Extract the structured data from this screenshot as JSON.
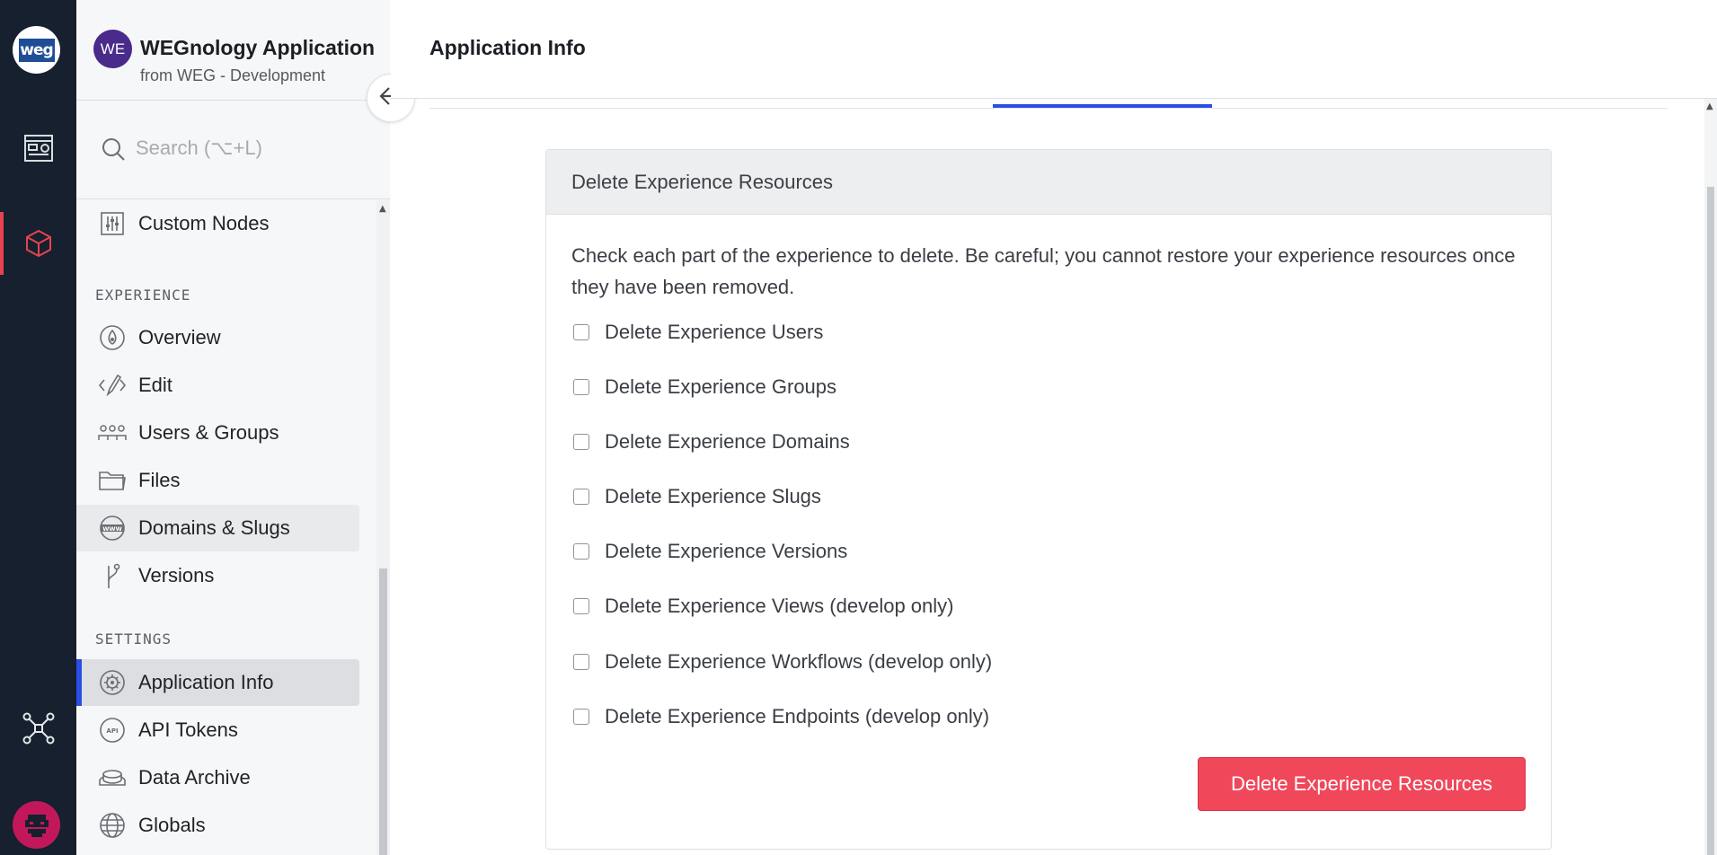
{
  "rail": {
    "logo_text": "weg",
    "items": [
      "dashboard-icon",
      "cube-icon",
      "integrations-icon"
    ],
    "accent": "#e8424e"
  },
  "app": {
    "avatar_text": "WE",
    "title": "WEGnology Application",
    "subtitle": "from WEG - Development"
  },
  "search": {
    "placeholder": "Search (⌥+L)"
  },
  "sidebar": {
    "custom_nodes": "Custom Nodes",
    "experience_label": "EXPERIENCE",
    "experience_items": [
      "Overview",
      "Edit",
      "Users & Groups",
      "Files",
      "Domains & Slugs",
      "Versions"
    ],
    "settings_label": "SETTINGS",
    "settings_items": [
      "Application Info",
      "API Tokens",
      "Data Archive",
      "Globals"
    ]
  },
  "page": {
    "title": "Application Info"
  },
  "panel": {
    "header": "Delete Experience Resources",
    "description": "Check each part of the experience to delete. Be careful; you cannot restore your experience resources once they have been removed.",
    "options": [
      "Delete Experience Users",
      "Delete Experience Groups",
      "Delete Experience Domains",
      "Delete Experience Slugs",
      "Delete Experience Versions",
      "Delete Experience Views (develop only)",
      "Delete Experience Workflows (develop only)",
      "Delete Experience Endpoints (develop only)"
    ],
    "button": "Delete Experience Resources"
  },
  "colors": {
    "primary": "#2b4ee6",
    "danger": "#f0475a",
    "rail": "#16202e"
  }
}
